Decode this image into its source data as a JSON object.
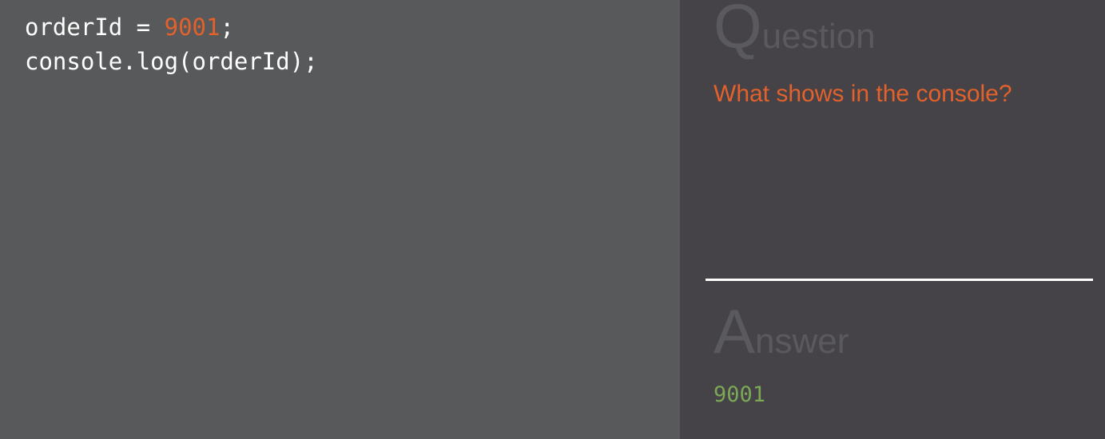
{
  "code": {
    "line1": {
      "before": "orderId = ",
      "number": "9001",
      "after": ";"
    },
    "line2": "console.log(orderId);"
  },
  "question": {
    "heading_initial": "Q",
    "heading_rest": "uestion",
    "text": "What shows in the console?"
  },
  "answer": {
    "heading_initial": "A",
    "heading_rest": "nswer",
    "text": "9001"
  },
  "colors": {
    "code_background": "#58595b",
    "panel_background": "#454348",
    "number_accent": "#e3612b",
    "question_accent": "#e3612b",
    "answer_accent": "#7ba855",
    "heading_gray": "#5a595d"
  }
}
